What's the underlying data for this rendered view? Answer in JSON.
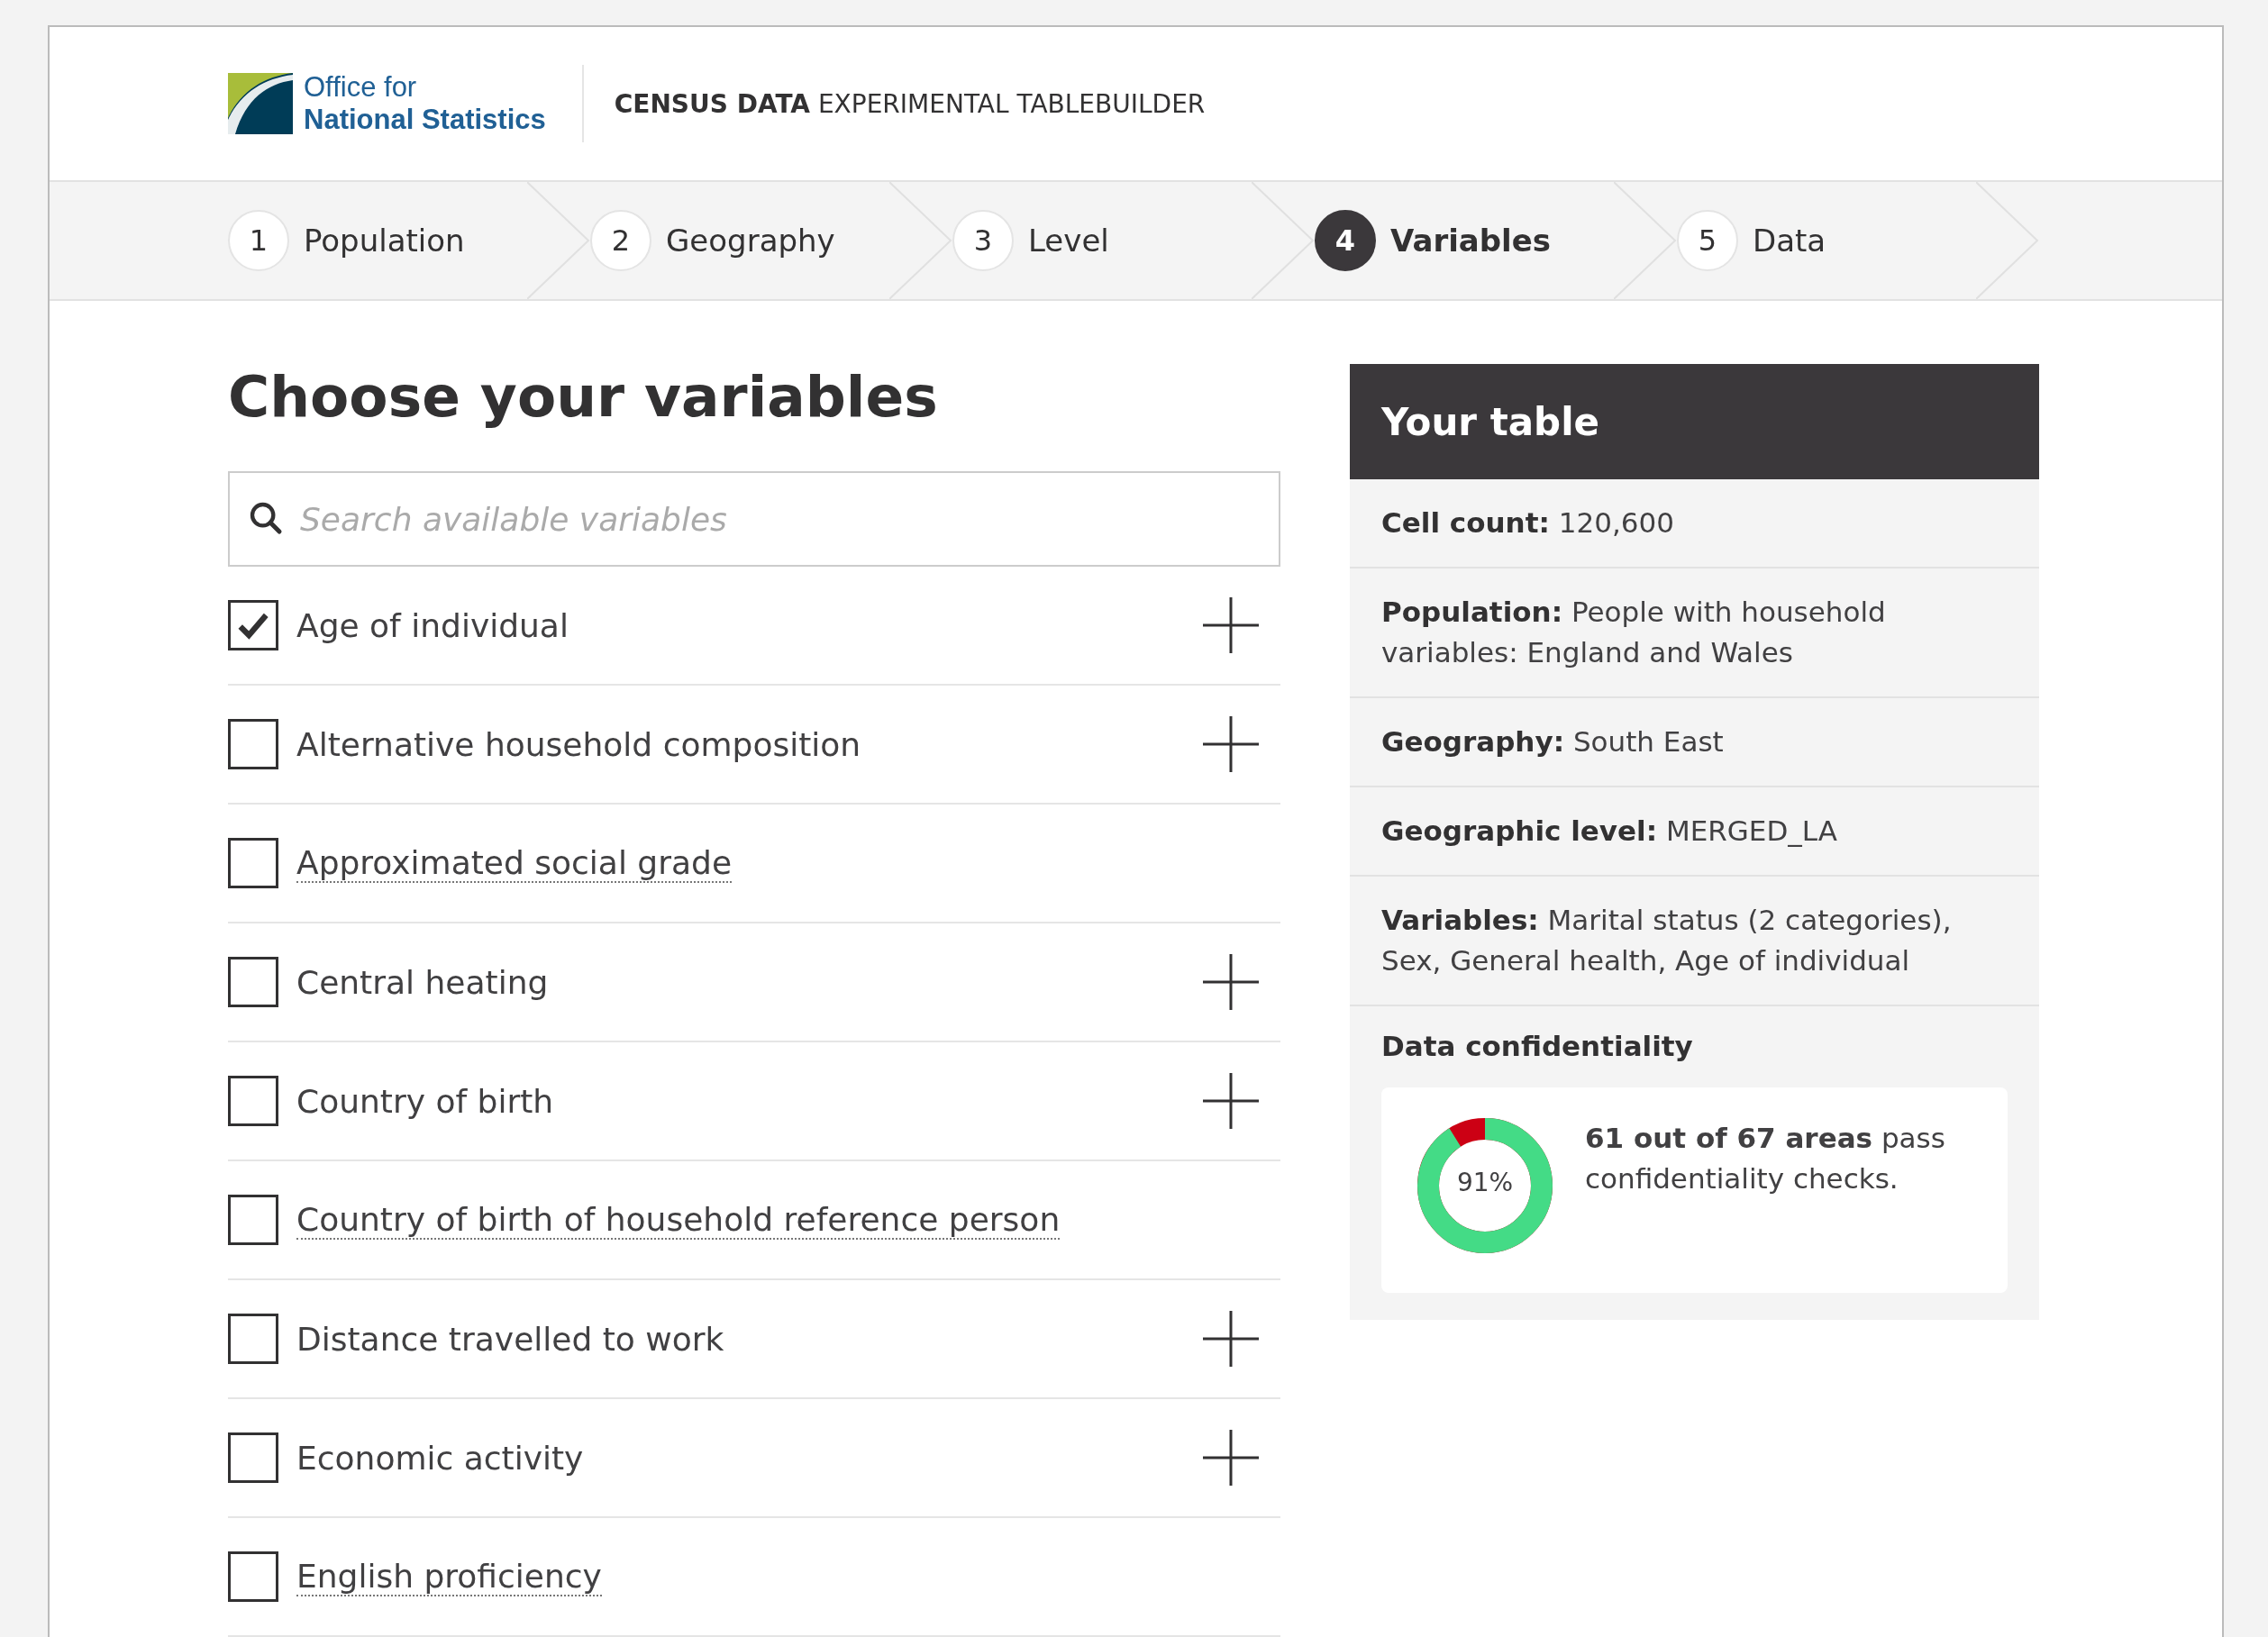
{
  "header": {
    "logo_line_1": "Office for",
    "logo_line_2": "National Statistics",
    "product_bold": "CENSUS DATA",
    "product_rest": "EXPERIMENTAL TABLEBUILDER"
  },
  "steps": [
    {
      "number": "1",
      "label": "Population",
      "selected": false
    },
    {
      "number": "2",
      "label": "Geography",
      "selected": false
    },
    {
      "number": "3",
      "label": "Level",
      "selected": false
    },
    {
      "number": "4",
      "label": "Variables",
      "selected": true
    },
    {
      "number": "5",
      "label": "Data",
      "selected": false
    }
  ],
  "title": "Choose your variables",
  "search": {
    "placeholder": "Search available variables"
  },
  "variables": [
    {
      "label": "Age of individual",
      "kind": "expandable",
      "checked": true
    },
    {
      "label": "Alternative household composition",
      "kind": "expandable",
      "checked": false
    },
    {
      "label": "Approximated social grade",
      "kind": "link",
      "checked": false
    },
    {
      "label": "Central heating",
      "kind": "expandable",
      "checked": false
    },
    {
      "label": "Country of birth",
      "kind": "expandable",
      "checked": false
    },
    {
      "label": "Country of birth of household reference person",
      "kind": "link",
      "checked": false
    },
    {
      "label": "Distance travelled to work",
      "kind": "expandable",
      "checked": false
    },
    {
      "label": "Economic activity",
      "kind": "expandable",
      "checked": false
    },
    {
      "label": "English proficiency",
      "kind": "link",
      "checked": false
    }
  ],
  "your_table": {
    "title": "Your table",
    "rows": [
      {
        "text": "**Cell count:** 120,600"
      },
      {
        "text": "**Population:** People with household variables: England and Wales"
      },
      {
        "text": "**Geography:** South East"
      },
      {
        "text": "**Geographic level:** MERGED_LA"
      },
      {
        "text": "**Variables:** Marital status (2 categories), Sex, General health, Age of individual"
      }
    ],
    "confidentiality": {
      "heading": "Data confidentiality",
      "reading": "91%",
      "message": "**61 out of 67 areas** pass confidentiality checks."
    }
  }
}
